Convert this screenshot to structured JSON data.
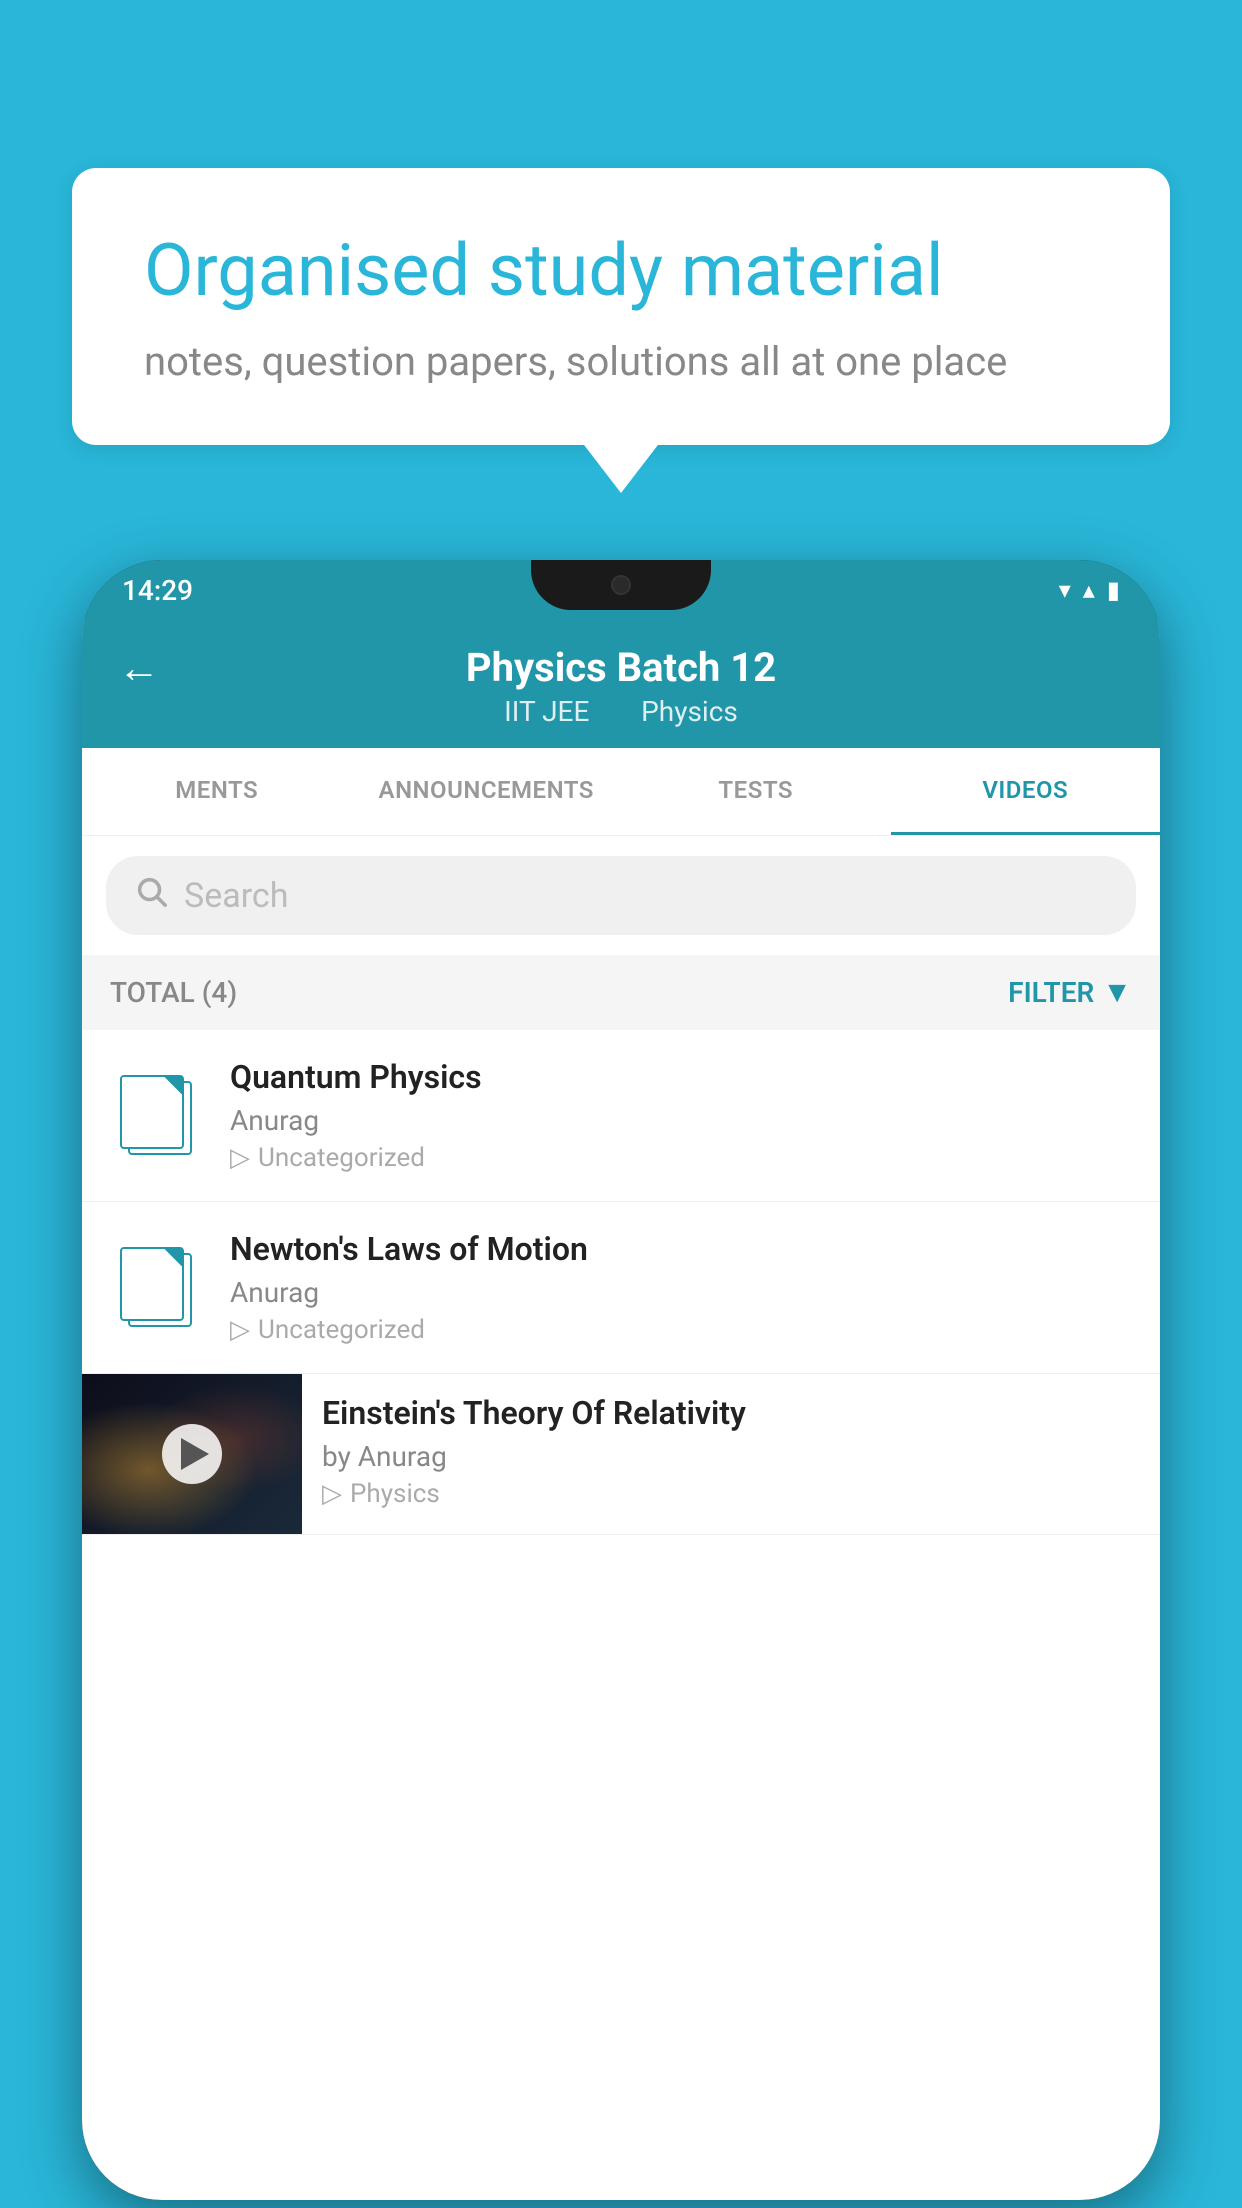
{
  "background_color": "#29b6d8",
  "speech_bubble": {
    "title": "Organised study material",
    "subtitle": "notes, question papers, solutions all at one place"
  },
  "status_bar": {
    "time": "14:29",
    "wifi_icon": "▼",
    "signal_icon": "▲",
    "battery_icon": "▮"
  },
  "app_header": {
    "title": "Physics Batch 12",
    "subtitle_1": "IIT JEE",
    "subtitle_2": "Physics",
    "back_label": "←"
  },
  "tabs": [
    {
      "label": "MENTS",
      "active": false
    },
    {
      "label": "ANNOUNCEMENTS",
      "active": false
    },
    {
      "label": "TESTS",
      "active": false
    },
    {
      "label": "VIDEOS",
      "active": true
    }
  ],
  "search": {
    "placeholder": "Search"
  },
  "filter_row": {
    "total_label": "TOTAL (4)",
    "filter_label": "FILTER"
  },
  "videos": [
    {
      "title": "Quantum Physics",
      "author": "Anurag",
      "tag": "Uncategorized",
      "has_thumbnail": false
    },
    {
      "title": "Newton's Laws of Motion",
      "author": "Anurag",
      "tag": "Uncategorized",
      "has_thumbnail": false
    },
    {
      "title": "Einstein's Theory Of Relativity",
      "author": "by Anurag",
      "tag": "Physics",
      "has_thumbnail": true
    }
  ],
  "colors": {
    "accent": "#2196a8",
    "text_primary": "#222",
    "text_secondary": "#888",
    "text_muted": "#aaa"
  }
}
